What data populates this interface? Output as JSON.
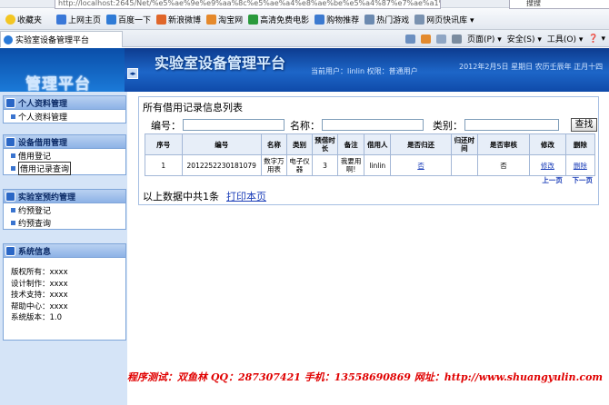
{
  "browser": {
    "address_url": "http://localhost:2645/Net/%e5%ae%9e%e9%aa%8c%e5%ae%a4%e8%ae%be%e5%a4%87%e7%ae%a1%e7%",
    "search_text": "搜搜",
    "favorites_label": "收藏夹",
    "favorites": [
      "上网主页",
      "百度一下",
      "新浪微博",
      "淘宝网",
      "高清免费电影",
      "购物推荐",
      "热门游戏",
      "网页快讯库 ▾"
    ],
    "favorite_colors": [
      "#f0c020",
      "#3a78d8",
      "#2f7bd6",
      "#e0662a",
      "#e5892b",
      "#2a9a3c",
      "#3c7ad0",
      "#6c8ab0",
      "#7a92b0"
    ],
    "tab_title": "实验室设备管理平台",
    "commands": [
      "页面(P) ▾",
      "安全(S) ▾",
      "工具(O) ▾",
      "❓ ▾"
    ]
  },
  "header": {
    "logo_text": "管理平台",
    "collapse_glyph": "◂▸",
    "system_title": "实验室设备管理平台",
    "user_info": "当前用户：linlin  权限：普通用户",
    "date_info": "2012年2月5日  星期日  农历壬辰年  正月十四"
  },
  "sidebar": {
    "sections": [
      {
        "title": "个人资料管理",
        "items": [
          "个人资料管理"
        ]
      },
      {
        "title": "设备借用管理",
        "items": [
          "借用登记",
          "借用记录查询"
        ]
      },
      {
        "title": "实验室预约管理",
        "items": [
          "约预登记",
          "约预查询"
        ]
      }
    ],
    "selected_item": "借用记录查询",
    "info_title": "系统信息",
    "info_lines": [
      "版权所有：xxxx",
      "设计制作：xxxx",
      "技术支持：xxxx",
      "帮助中心：xxxx",
      "系统版本：1.0"
    ]
  },
  "main": {
    "title": "所有借用记录信息列表",
    "search": {
      "number_label": "编号：",
      "number_value": "",
      "name_label": "名称：",
      "name_value": "",
      "category_label": "类别：",
      "category_value": "",
      "button_label": "查找"
    },
    "table": {
      "headers": [
        "序号",
        "编号",
        "名称",
        "类别",
        "预借时长",
        "备注",
        "借用人",
        "是否归还",
        "归还时间",
        "是否审核",
        "修改",
        "删除"
      ],
      "rows": [
        [
          "1",
          "2012252230181079",
          "数字万用表",
          "电子仪器",
          "3",
          "我要用啊!",
          "linlin",
          "否",
          "",
          "否",
          "修改",
          "删除"
        ]
      ]
    },
    "pager": [
      "上一页",
      "下一页"
    ],
    "summary": "以上数据中共1条",
    "print_link": "打印本页"
  },
  "credits": "程序测试：双鱼林    QQ：287307421    手机：13558690869    网址：http://www.shuangyulin.com"
}
